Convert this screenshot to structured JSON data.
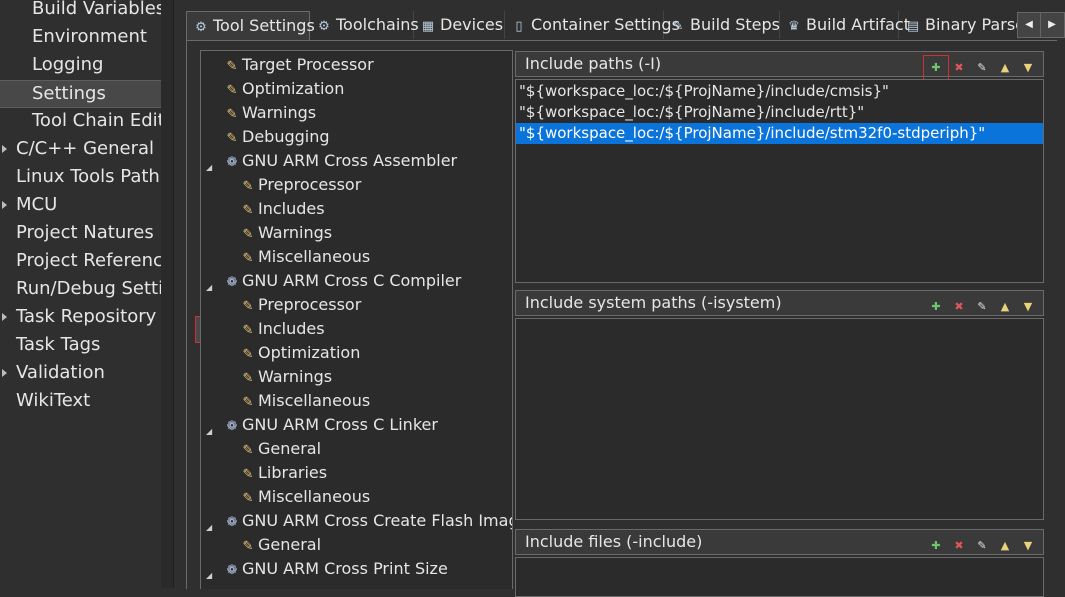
{
  "left_nav": {
    "items": [
      {
        "label": "Build Variables",
        "indent": true
      },
      {
        "label": "Environment",
        "indent": true
      },
      {
        "label": "Logging",
        "indent": true
      },
      {
        "label": "Settings",
        "indent": true,
        "selected": true
      },
      {
        "label": "Tool Chain Editor",
        "indent": true
      },
      {
        "label": "C/C++ General",
        "expandable": true
      },
      {
        "label": "Linux Tools Path"
      },
      {
        "label": "MCU",
        "expandable": true
      },
      {
        "label": "Project Natures"
      },
      {
        "label": "Project References"
      },
      {
        "label": "Run/Debug Settings"
      },
      {
        "label": "Task Repository",
        "expandable": true
      },
      {
        "label": "Task Tags"
      },
      {
        "label": "Validation",
        "expandable": true
      },
      {
        "label": "WikiText"
      }
    ]
  },
  "tabs": [
    {
      "label": "Tool Settings",
      "icon": "gear-icon",
      "active": true
    },
    {
      "label": "Toolchains",
      "icon": "gear-icon"
    },
    {
      "label": "Devices",
      "icon": "chip-icon"
    },
    {
      "label": "Container Settings",
      "icon": "container-icon"
    },
    {
      "label": "Build Steps",
      "icon": "wrench-icon"
    },
    {
      "label": "Build Artifact",
      "icon": "trophy-icon"
    },
    {
      "label": "Binary Parser",
      "icon": "binary-icon"
    }
  ],
  "tree": {
    "items": [
      {
        "label": "Target Processor",
        "level": 1,
        "icon": "settings-page-icon"
      },
      {
        "label": "Optimization",
        "level": 1,
        "icon": "settings-page-icon"
      },
      {
        "label": "Warnings",
        "level": 1,
        "icon": "settings-page-icon"
      },
      {
        "label": "Debugging",
        "level": 1,
        "icon": "settings-page-icon"
      },
      {
        "label": "GNU ARM Cross Assembler",
        "level": 1,
        "icon": "tool-gear-icon",
        "expanded": true
      },
      {
        "label": "Preprocessor",
        "level": 2,
        "icon": "settings-page-icon"
      },
      {
        "label": "Includes",
        "level": 2,
        "icon": "settings-page-icon"
      },
      {
        "label": "Warnings",
        "level": 2,
        "icon": "settings-page-icon"
      },
      {
        "label": "Miscellaneous",
        "level": 2,
        "icon": "settings-page-icon"
      },
      {
        "label": "GNU ARM Cross C Compiler",
        "level": 1,
        "icon": "tool-gear-icon",
        "expanded": true
      },
      {
        "label": "Preprocessor",
        "level": 2,
        "icon": "settings-page-icon"
      },
      {
        "label": "Includes",
        "level": 2,
        "icon": "settings-page-icon",
        "selected": true
      },
      {
        "label": "Optimization",
        "level": 2,
        "icon": "settings-page-icon"
      },
      {
        "label": "Warnings",
        "level": 2,
        "icon": "settings-page-icon"
      },
      {
        "label": "Miscellaneous",
        "level": 2,
        "icon": "settings-page-icon"
      },
      {
        "label": "GNU ARM Cross C Linker",
        "level": 1,
        "icon": "tool-gear-icon",
        "expanded": true
      },
      {
        "label": "General",
        "level": 2,
        "icon": "settings-page-icon"
      },
      {
        "label": "Libraries",
        "level": 2,
        "icon": "settings-page-icon"
      },
      {
        "label": "Miscellaneous",
        "level": 2,
        "icon": "settings-page-icon"
      },
      {
        "label": "GNU ARM Cross Create Flash Image",
        "level": 1,
        "icon": "tool-gear-icon",
        "expanded": true
      },
      {
        "label": "General",
        "level": 2,
        "icon": "settings-page-icon"
      },
      {
        "label": "GNU ARM Cross Print Size",
        "level": 1,
        "icon": "tool-gear-icon",
        "expanded": true
      }
    ]
  },
  "panes": {
    "include_paths": {
      "title": "Include paths (-I)",
      "items": [
        {
          "value": "\"${workspace_loc:/${ProjName}/include/cmsis}\""
        },
        {
          "value": "\"${workspace_loc:/${ProjName}/include/rtt}\""
        },
        {
          "value": "\"${workspace_loc:/${ProjName}/include/stm32f0-stdperiph}\"",
          "selected": true
        }
      ]
    },
    "include_system_paths": {
      "title": "Include system paths (-isystem)",
      "items": []
    },
    "include_files": {
      "title": "Include files (-include)",
      "items": []
    }
  },
  "toolbar_buttons": [
    "add-icon",
    "delete-icon",
    "edit-icon",
    "move-up-icon",
    "move-down-icon"
  ],
  "colors": {
    "selection": "#0a74da",
    "highlight_box": "#d03030"
  }
}
